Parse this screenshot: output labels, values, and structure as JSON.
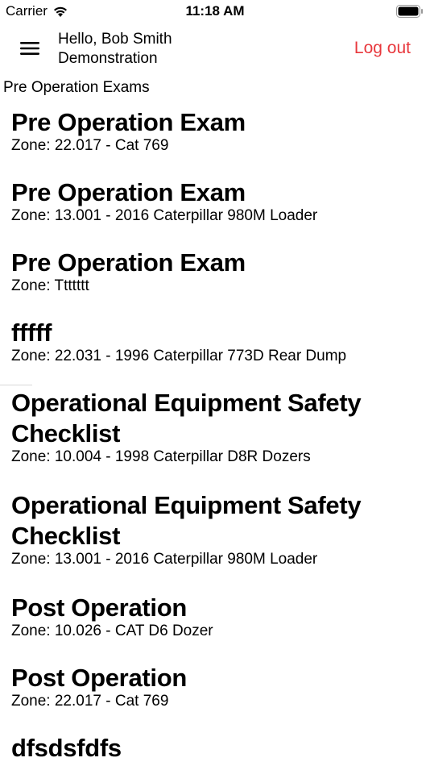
{
  "status_bar": {
    "carrier": "Carrier",
    "time": "11:18 AM"
  },
  "header": {
    "greeting_line1": "Hello, Bob Smith",
    "greeting_line2": "Demonstration",
    "logout_label": "Log out",
    "logout_color": "#e8383d"
  },
  "section_title": "Pre Operation Exams",
  "exams": [
    {
      "title": "Pre Operation Exam",
      "zone": "Zone: 22.017 - Cat 769"
    },
    {
      "title": "Pre Operation Exam",
      "zone": "Zone: 13.001 - 2016 Caterpillar 980M Loader"
    },
    {
      "title": "Pre Operation Exam",
      "zone": "Zone: Ttttttt"
    },
    {
      "title": "fffff",
      "zone": "Zone: 22.031 - 1996 Caterpillar 773D Rear Dump"
    },
    {
      "title": "Operational Equipment Safety Checklist",
      "zone": "Zone: 10.004 - 1998 Caterpillar D8R Dozers"
    },
    {
      "title": "Operational Equipment Safety Checklist",
      "zone": "Zone: 13.001 - 2016 Caterpillar 980M Loader"
    },
    {
      "title": "Post Operation",
      "zone": "Zone: 10.026 - CAT D6 Dozer"
    },
    {
      "title": "Post Operation",
      "zone": "Zone: 22.017 - Cat 769"
    },
    {
      "title": "dfsdsfdfs",
      "zone": ""
    }
  ]
}
